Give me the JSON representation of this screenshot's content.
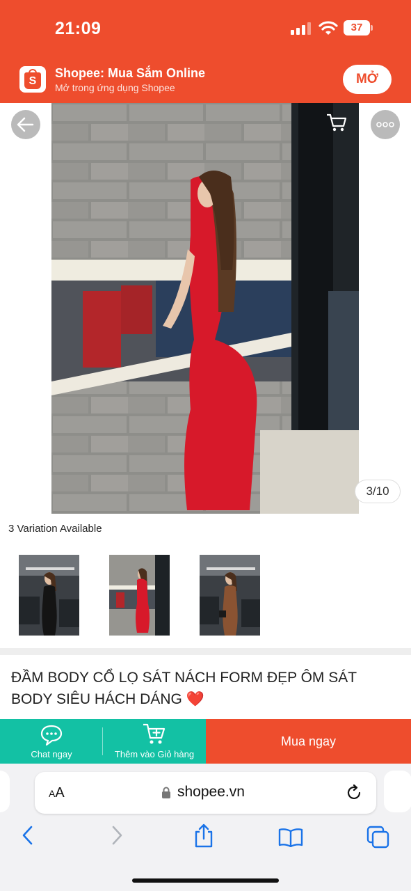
{
  "status_bar": {
    "time": "21:09",
    "battery": "37",
    "icons": [
      "signal-icon",
      "wifi-icon",
      "battery-icon"
    ]
  },
  "app_banner": {
    "name": "Shopee: Mua Sắm Online",
    "subtitle": "Mở trong ứng dụng Shopee",
    "open_label": "MỞ",
    "logo_letter": "S"
  },
  "product": {
    "image_counter": "3/10",
    "variation_text": "3 Variation Available",
    "title": "ĐẦM BODY CỔ LỌ SÁT NÁCH FORM ĐẸP ÔM SÁT BODY SIÊU HÁCH DÁNG",
    "title_emoji": "❤️",
    "variations": [
      "black-dress",
      "red-dress",
      "brown-dress"
    ]
  },
  "actions": {
    "chat_label": "Chat ngay",
    "add_cart_label": "Thêm vào Giỏ hàng",
    "buy_label": "Mua ngay"
  },
  "browser": {
    "text_size_small": "A",
    "text_size_large": "A",
    "url": "shopee.vn"
  },
  "colors": {
    "brand": "#ee4d2d",
    "teal": "#13c1a4"
  }
}
